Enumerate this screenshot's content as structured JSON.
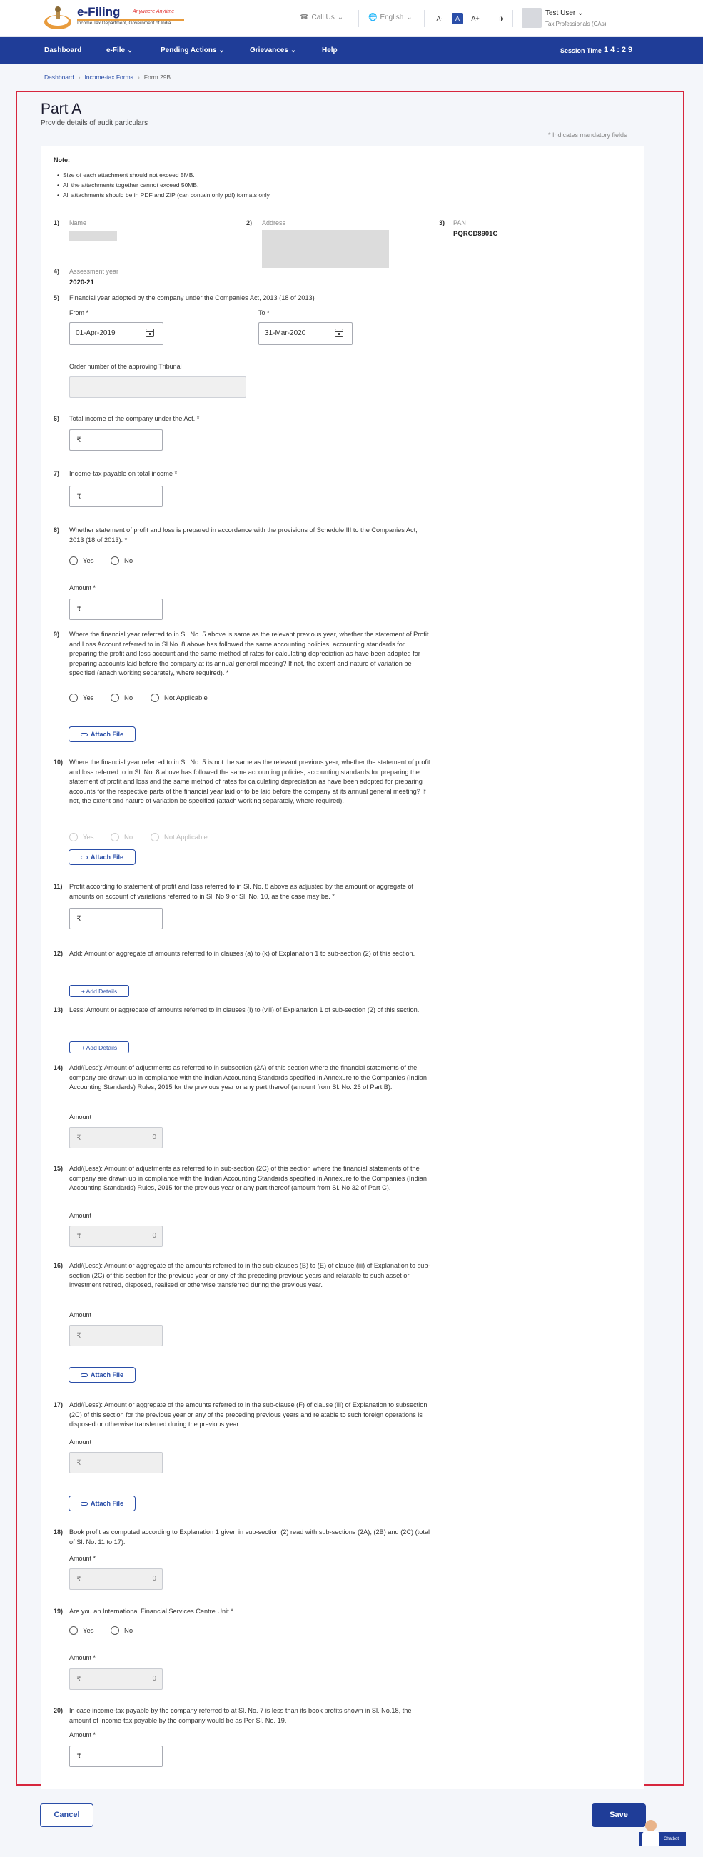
{
  "header": {
    "logo_title": "e-Filing",
    "logo_tagline": "Anywhere Anytime",
    "logo_subtitle": "Income Tax Department, Government of India",
    "call_us": "Call Us",
    "language": "English",
    "font_decrease": "A-",
    "font_normal": "A",
    "font_increase": "A+",
    "user_name": "Test User",
    "user_role": "Tax Professionals (CAs)"
  },
  "nav": {
    "items": [
      "Dashboard",
      "e-File",
      "Pending Actions",
      "Grievances",
      "Help"
    ],
    "session_label": "Session Time",
    "session_value": "14:29"
  },
  "breadcrumb": {
    "dashboard": "Dashboard",
    "forms": "Income-tax Forms",
    "current": "Form 29B"
  },
  "page": {
    "title": "Part A",
    "subtitle": "Provide details of audit particulars",
    "mandatory_note": "* Indicates mandatory fields"
  },
  "note": {
    "heading": "Note:",
    "bullets": [
      "Size of each attachment should not exceed 5MB.",
      "All the attachments together cannot exceed 50MB.",
      "All attachments should be in PDF and ZIP (can contain only pdf) formats only."
    ]
  },
  "fields": {
    "q1": "1)",
    "q1_label": "Name",
    "q2": "2)",
    "q2_label": "Address",
    "q3": "3)",
    "q3_label": "PAN",
    "q3_value": "PQRCD8901C",
    "q4": "4)",
    "q4_label": "Assessment year",
    "q4_value": "2020-21",
    "q5": "5)",
    "q5_text": "Financial year adopted by the company under the Companies Act, 2013 (18 of 2013)",
    "from_label": "From *",
    "from_value": "01-Apr-2019",
    "to_label": "To *",
    "to_value": "31-Mar-2020",
    "tribunal_label": "Order number of the approving Tribunal",
    "q6": "6)",
    "q6_text": "Total income of the company under the Act. *",
    "q7": "7)",
    "q7_text": "Income-tax payable on total income *",
    "q8": "8)",
    "q8_text": "Whether statement of profit and loss is prepared in accordance with the provisions of Schedule III to the Companies Act, 2013 (18 of 2013). *",
    "q8_amount": "Amount *",
    "q9": "9)",
    "q9_text": "Where the financial year referred to in Sl. No. 5 above is same as the relevant previous year, whether the statement of Profit and Loss Account referred to in Sl No. 8 above has followed the same accounting policies, accounting standards for preparing the profit and loss account and the same method of rates for calculating depreciation as have been adopted for preparing accounts laid before the company at its annual general meeting? If not, the extent and nature of variation be specified (attach working separately, where required). *",
    "q10": "10)",
    "q10_text": "Where the financial year referred to in Sl. No. 5 is not the same as the relevant previous year, whether the statement of profit and loss referred to in Sl. No. 8 above has followed the same accounting policies, accounting standards for preparing the statement of profit and loss and the same method of rates for calculating depreciation as have been adopted for preparing accounts for the respective parts of the financial year laid or to be laid before the company at its annual general meeting? If not, the extent and nature of variation be specified (attach working separately, where required).",
    "q11": "11)",
    "q11_text": "Profit according to statement of profit and loss referred to in Sl. No. 8 above as adjusted by the amount or aggregate of amounts on account of variations referred to in Sl. No 9 or Sl. No. 10, as the case may be. *",
    "q12": "12)",
    "q12_text": "Add: Amount or aggregate of amounts referred to in clauses (a) to (k) of Explanation 1 to sub-section (2) of this section.",
    "q13": "13)",
    "q13_text": "Less: Amount or aggregate of amounts referred to in clauses (i) to (viii) of Explanation 1 of sub-section (2) of this section.",
    "q14": "14)",
    "q14_text": "Add/(Less): Amount of adjustments as referred to in subsection (2A) of this section where the financial statements of the company are drawn up in compliance with the Indian Accounting Standards specified in Annexure to the Companies (Indian Accounting Standards) Rules, 2015 for the previous year or any part thereof (amount from Sl. No. 26 of Part B).",
    "q15": "15)",
    "q15_text": "Add/(Less): Amount of adjustments as referred to in sub-section (2C) of this section where the financial statements of the company are drawn up in compliance with the Indian Accounting Standards specified in Annexure to the Companies (Indian Accounting Standards) Rules, 2015 for the previous year or any part thereof (amount from Sl. No 32 of Part C).",
    "q16": "16)",
    "q16_text": "Add/(Less): Amount or aggregate of the amounts referred to in the sub-clauses (B) to (E) of clause (iii) of Explanation to sub-section (2C) of this section for the previous year or any of the preceding previous years and relatable to such asset or investment retired, disposed, realised or otherwise transferred during the previous year.",
    "q17": "17)",
    "q17_text": "Add/(Less): Amount or aggregate of the amounts referred to in the sub-clause (F) of clause (iii) of Explanation to subsection (2C) of this section for the previous year or any of the preceding previous years and relatable to such foreign operations is disposed or otherwise transferred during the previous year.",
    "q18": "18)",
    "q18_text": "Book profit as computed according to Explanation 1 given in sub-section (2) read with sub-sections (2A), (2B) and (2C) (total of Sl. No. 11 to 17).",
    "q19": "19)",
    "q19_text": "Are you an International Financial Services Centre Unit *",
    "q20": "20)",
    "q20_text": "In case income-tax payable by the company referred to at Sl. No. 7 is less than its book profits shown in Sl. No.18, the amount of income-tax payable by the company would be as Per Sl. No. 19.",
    "amount": "Amount",
    "amount_req": "Amount *",
    "yes": "Yes",
    "no": "No",
    "na": "Not Applicable",
    "rupee": "₹",
    "zero": "0",
    "attach": "Attach File",
    "add_details": "+ Add Details"
  },
  "footer": {
    "cancel": "Cancel",
    "save": "Save",
    "chatbot": "Chatbot"
  }
}
